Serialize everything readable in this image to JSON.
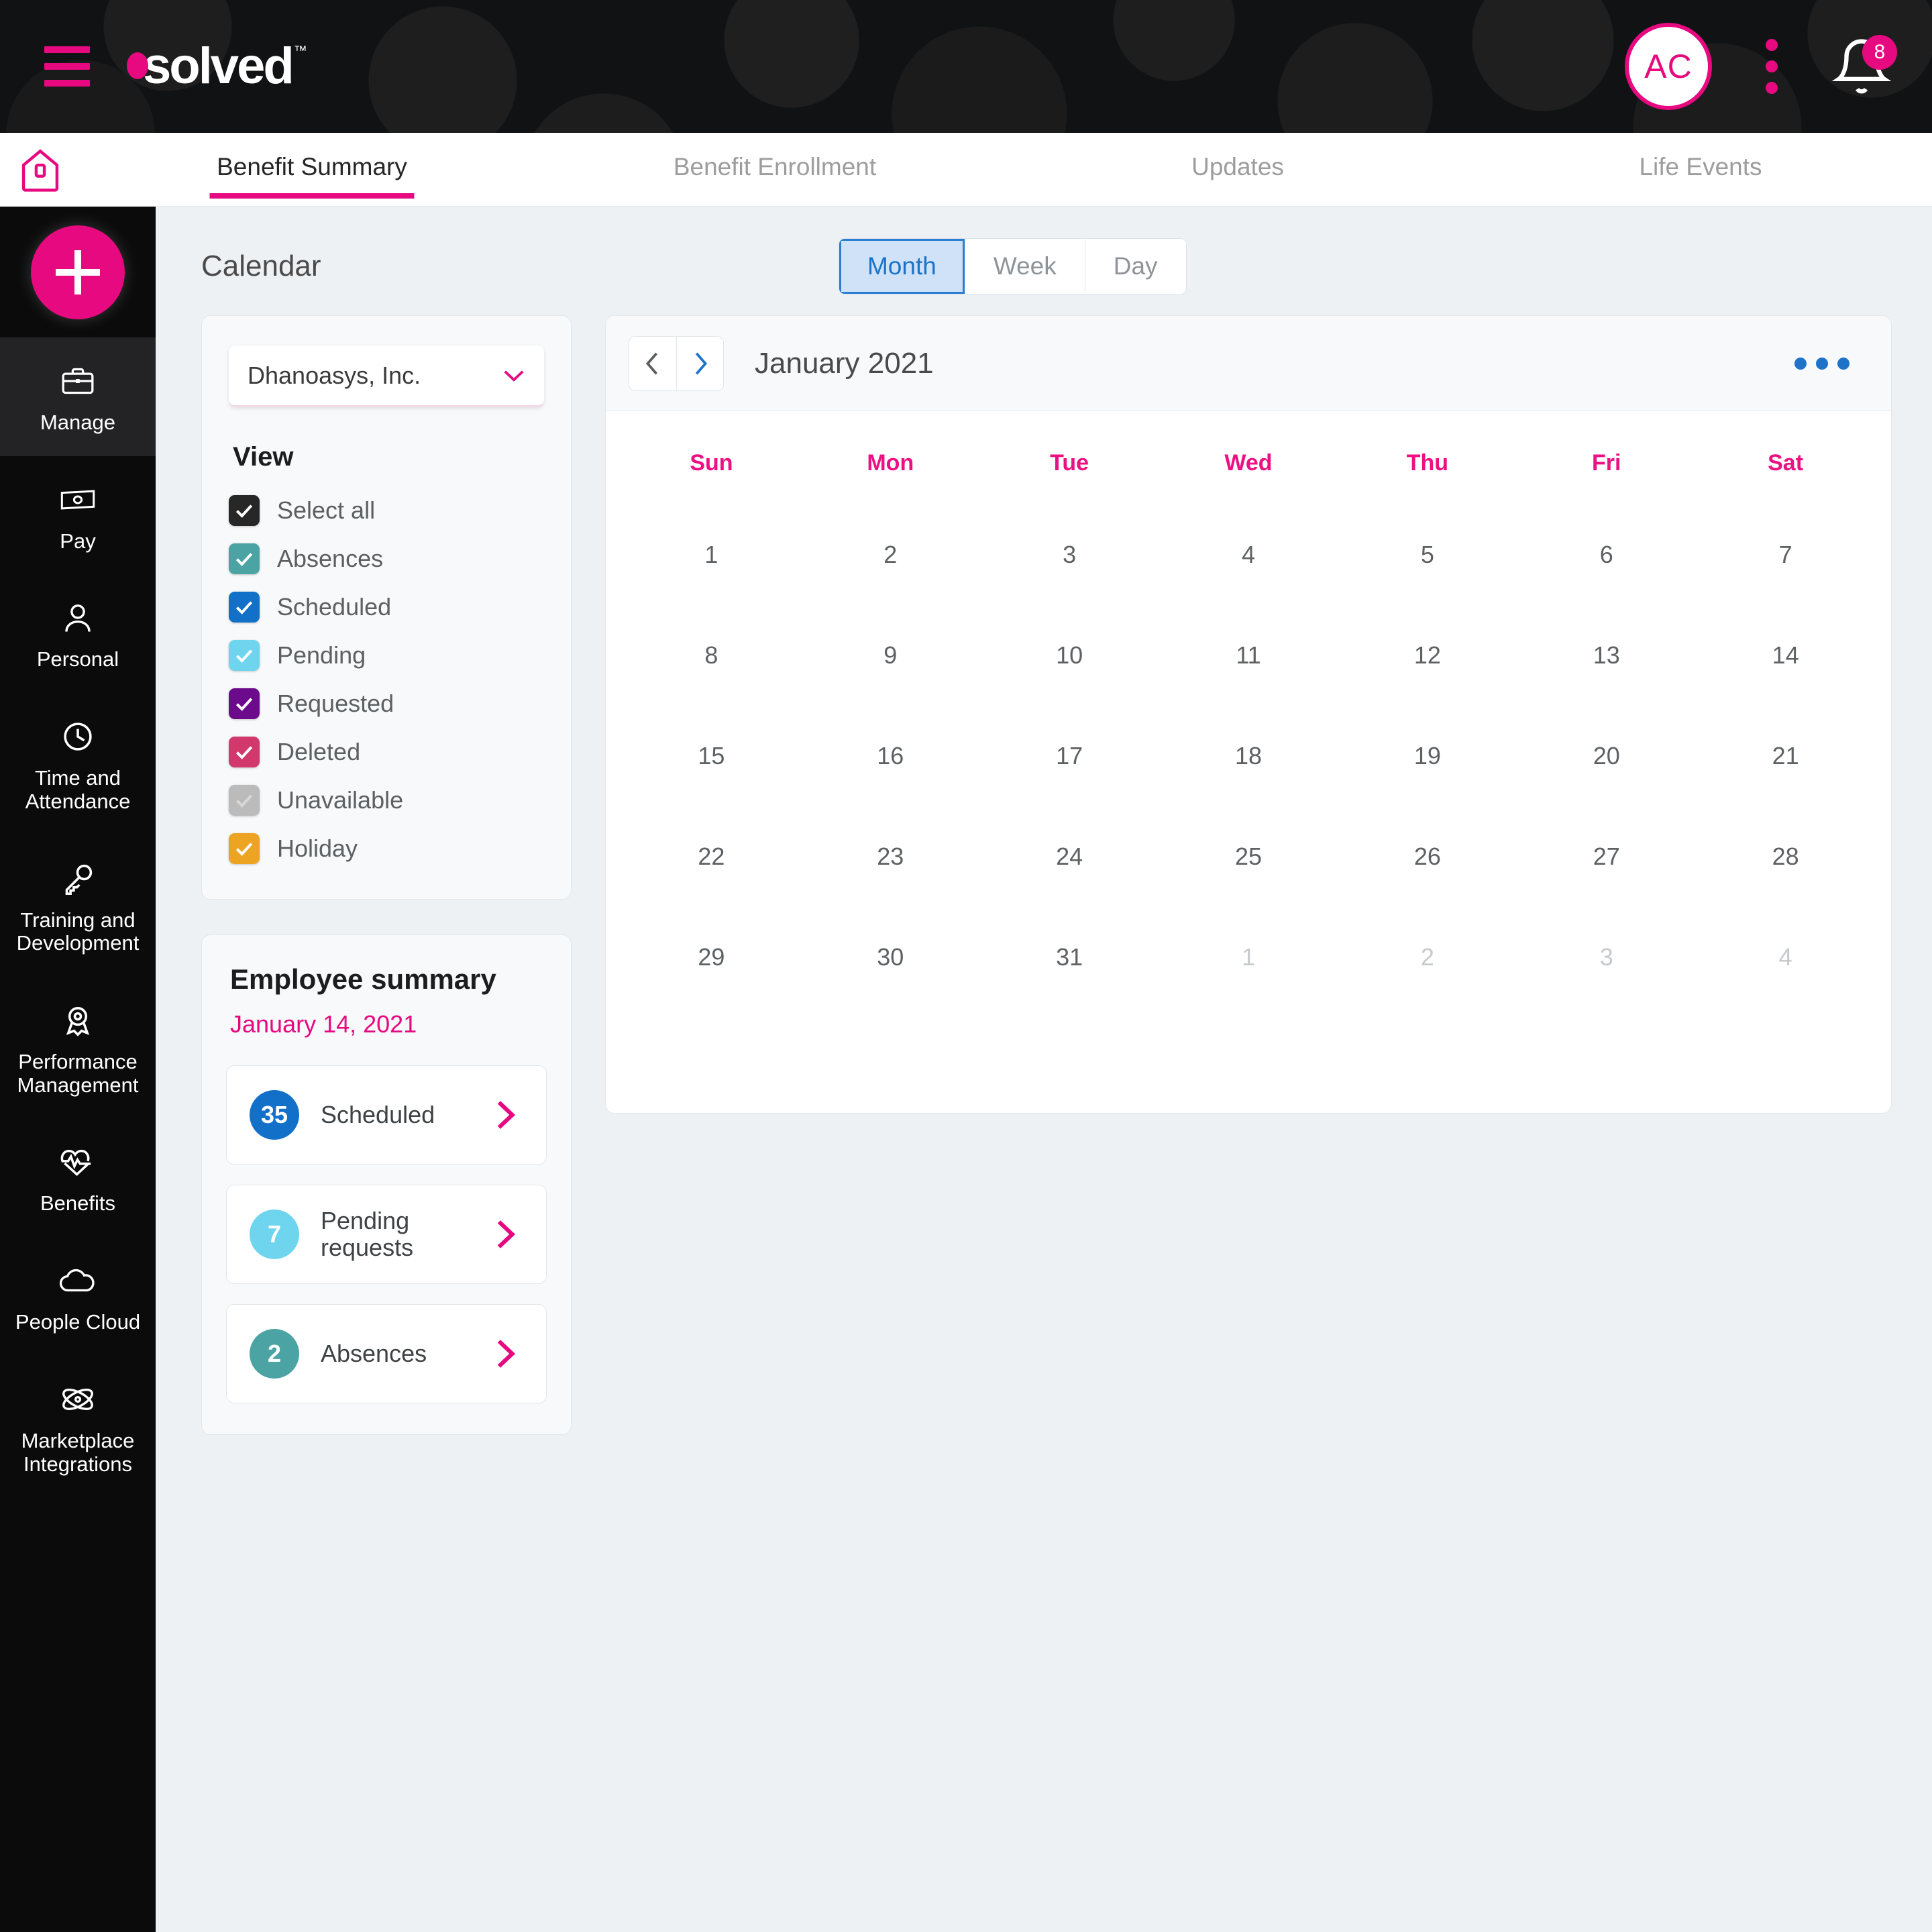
{
  "brand": {
    "name": "solved",
    "tm": "™"
  },
  "topbar": {
    "avatar_initials": "AC",
    "notification_count": "8"
  },
  "tabs": [
    {
      "label": "Benefit Summary",
      "active": true
    },
    {
      "label": "Benefit Enrollment",
      "active": false
    },
    {
      "label": "Updates",
      "active": false
    },
    {
      "label": "Life Events",
      "active": false
    }
  ],
  "sidebar": {
    "add_button": "+",
    "items": [
      {
        "label": "Manage",
        "icon": "briefcase-icon",
        "active": true
      },
      {
        "label": "Pay",
        "icon": "money-icon",
        "active": false
      },
      {
        "label": "Personal",
        "icon": "person-icon",
        "active": false
      },
      {
        "label": "Time and Attendance",
        "icon": "clock-icon",
        "active": false
      },
      {
        "label": "Training and Development",
        "icon": "key-icon",
        "active": false
      },
      {
        "label": "Performance Management",
        "icon": "award-icon",
        "active": false
      },
      {
        "label": "Benefits",
        "icon": "heartbeat-icon",
        "active": false
      },
      {
        "label": "People Cloud",
        "icon": "cloud-icon",
        "active": false
      },
      {
        "label": "Marketplace Integrations",
        "icon": "atom-icon",
        "active": false
      }
    ]
  },
  "page": {
    "title": "Calendar",
    "view_modes": [
      {
        "label": "Month",
        "active": true
      },
      {
        "label": "Week",
        "active": false
      },
      {
        "label": "Day",
        "active": false
      }
    ]
  },
  "filters": {
    "company_selected": "Dhanoasys, Inc.",
    "view_heading": "View",
    "checkboxes": [
      {
        "label": "Select all",
        "color": "#272727",
        "checked": true
      },
      {
        "label": "Absences",
        "color": "#4ba3a3",
        "checked": true
      },
      {
        "label": "Scheduled",
        "color": "#1270c8",
        "checked": true
      },
      {
        "label": "Pending",
        "color": "#6fd4ee",
        "checked": true
      },
      {
        "label": "Requested",
        "color": "#6b0a8a",
        "checked": true
      },
      {
        "label": "Deleted",
        "color": "#d2386c",
        "checked": true
      },
      {
        "label": "Unavailable",
        "color": "#bbbbbb",
        "checked": true
      },
      {
        "label": "Holiday",
        "color": "#eda423",
        "checked": true
      }
    ]
  },
  "employee_summary": {
    "title": "Employee summary",
    "date": "January 14, 2021",
    "rows": [
      {
        "count": "35",
        "label": "Scheduled",
        "color": "#1270c8"
      },
      {
        "count": "7",
        "label": "Pending requests",
        "color": "#6fd4ee"
      },
      {
        "count": "2",
        "label": "Absences",
        "color": "#4ba3a3"
      }
    ]
  },
  "calendar": {
    "month_label": "January 2021",
    "prev_icon": "chevron-left-icon",
    "next_icon": "chevron-right-icon",
    "overflow_icon": "more-horizontal-icon",
    "day_headers": [
      "Sun",
      "Mon",
      "Tue",
      "Wed",
      "Thu",
      "Fri",
      "Sat"
    ],
    "weeks": [
      [
        {
          "d": "1",
          "muted": false
        },
        {
          "d": "2",
          "muted": false
        },
        {
          "d": "3",
          "muted": false
        },
        {
          "d": "4",
          "muted": false
        },
        {
          "d": "5",
          "muted": false
        },
        {
          "d": "6",
          "muted": false
        },
        {
          "d": "7",
          "muted": false
        }
      ],
      [
        {
          "d": "8",
          "muted": false
        },
        {
          "d": "9",
          "muted": false
        },
        {
          "d": "10",
          "muted": false
        },
        {
          "d": "11",
          "muted": false
        },
        {
          "d": "12",
          "muted": false
        },
        {
          "d": "13",
          "muted": false
        },
        {
          "d": "14",
          "muted": false
        }
      ],
      [
        {
          "d": "15",
          "muted": false
        },
        {
          "d": "16",
          "muted": false
        },
        {
          "d": "17",
          "muted": false
        },
        {
          "d": "18",
          "muted": false
        },
        {
          "d": "19",
          "muted": false
        },
        {
          "d": "20",
          "muted": false
        },
        {
          "d": "21",
          "muted": false
        }
      ],
      [
        {
          "d": "22",
          "muted": false
        },
        {
          "d": "23",
          "muted": false
        },
        {
          "d": "24",
          "muted": false
        },
        {
          "d": "25",
          "muted": false
        },
        {
          "d": "26",
          "muted": false
        },
        {
          "d": "27",
          "muted": false
        },
        {
          "d": "28",
          "muted": false
        }
      ],
      [
        {
          "d": "29",
          "muted": false
        },
        {
          "d": "30",
          "muted": false
        },
        {
          "d": "31",
          "muted": false
        },
        {
          "d": "1",
          "muted": true
        },
        {
          "d": "2",
          "muted": true
        },
        {
          "d": "3",
          "muted": true
        },
        {
          "d": "4",
          "muted": true
        }
      ]
    ]
  }
}
